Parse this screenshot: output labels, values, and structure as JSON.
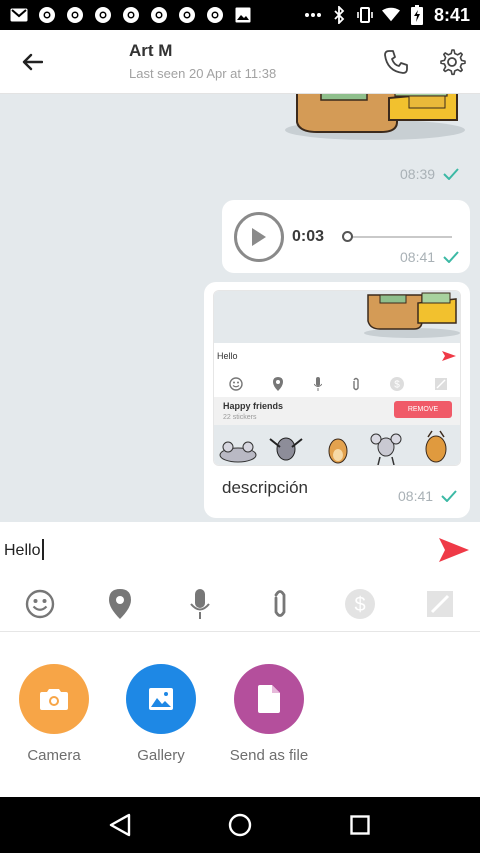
{
  "status_bar": {
    "time": "8:41",
    "icons": [
      "gmail-icon",
      "chrome-icon",
      "chrome-icon",
      "chrome-icon",
      "chrome-icon",
      "chrome-icon",
      "chrome-icon",
      "image-icon",
      "more-icon",
      "bluetooth-icon",
      "vibrate-icon",
      "wifi-icon",
      "battery-icon"
    ]
  },
  "header": {
    "contact_name": "Art M",
    "last_seen": "Last seen 20 Apr at 11:38"
  },
  "messages": {
    "sticker_time": "08:39",
    "voice": {
      "duration": "0:03",
      "progress": 0,
      "time": "08:41"
    },
    "screenshot": {
      "caption": "descripción",
      "time": "08:41",
      "embedded": {
        "input_text": "Hello",
        "pack_name": "Happy friends",
        "pack_count": "22 stickers",
        "remove_label": "REMOVE"
      }
    }
  },
  "composer": {
    "input_value": "Hello",
    "tools": [
      "emoji-icon",
      "location-icon",
      "microphone-icon",
      "attachment-icon",
      "money-icon",
      "sticker-icon"
    ]
  },
  "attach": {
    "camera_label": "Camera",
    "gallery_label": "Gallery",
    "file_label": "Send as file"
  },
  "colors": {
    "accent_red": "#ef3a47",
    "camera": "#f7a547",
    "gallery": "#1e88e5",
    "file": "#b44f9c",
    "check": "#3cb9a5",
    "chat_bg": "#e4e9ec"
  }
}
